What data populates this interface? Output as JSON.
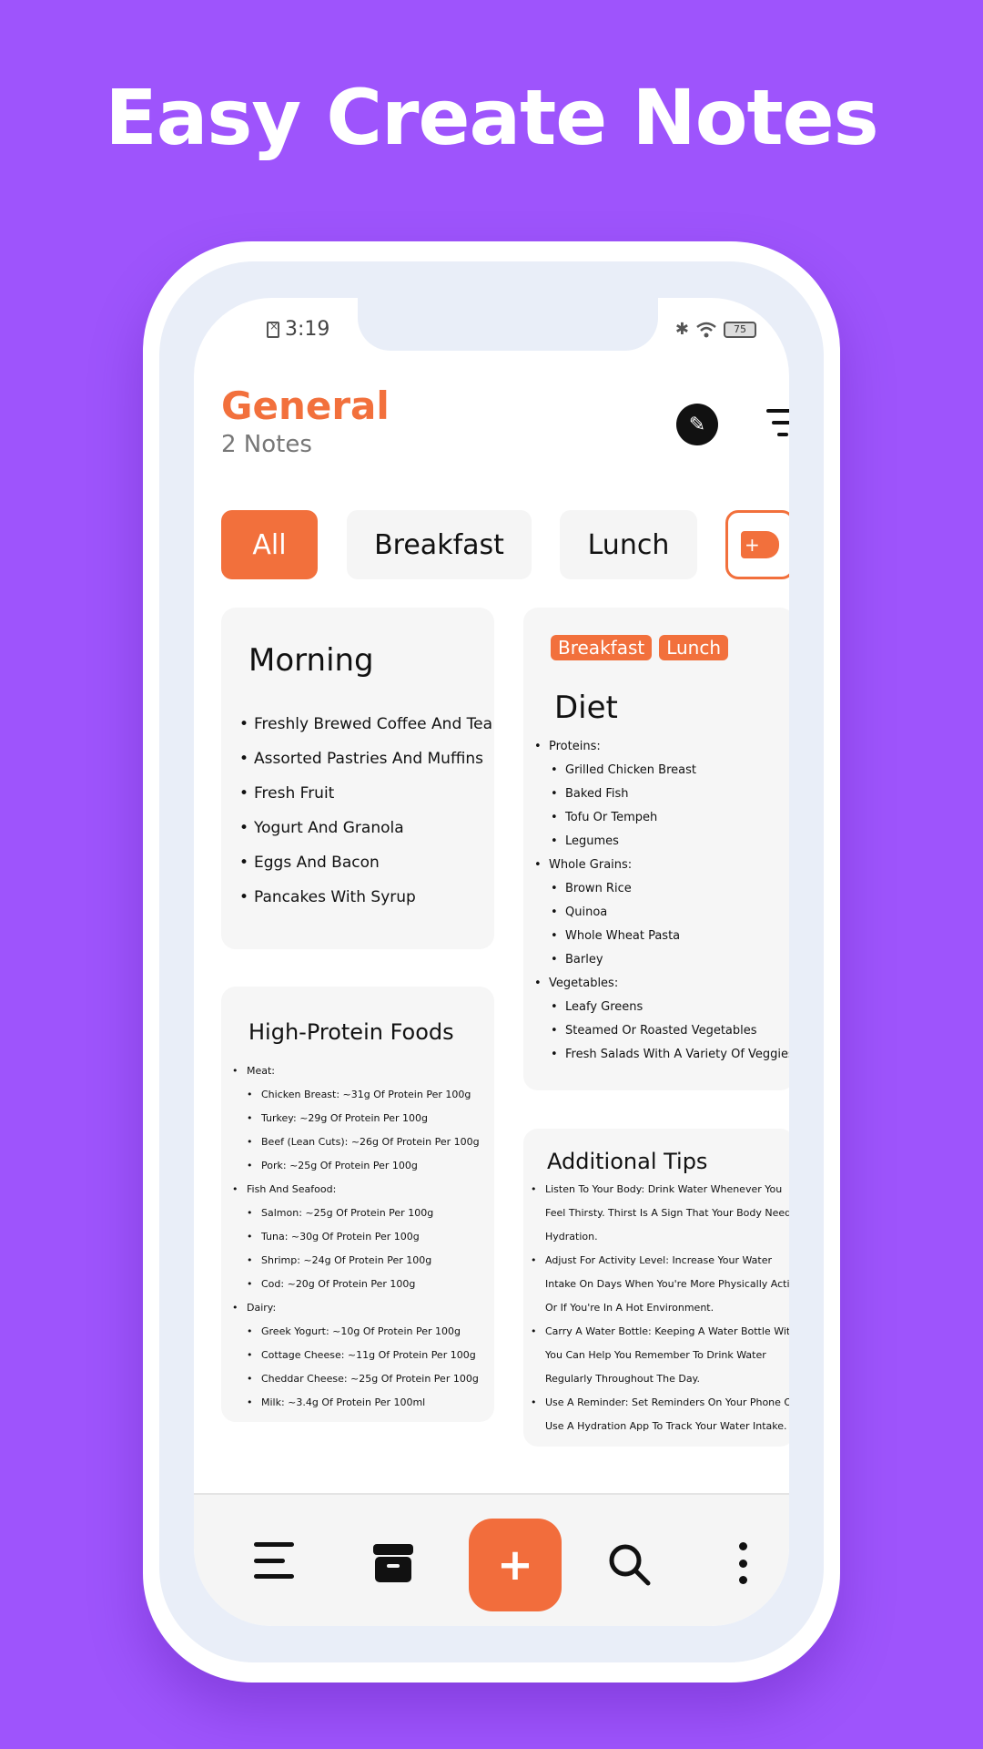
{
  "promo": {
    "headline": "Easy Create Notes"
  },
  "status_bar": {
    "time": "3:19",
    "battery": "75"
  },
  "header": {
    "title": "General",
    "subtitle": "2 Notes"
  },
  "chips": [
    {
      "label": "All"
    },
    {
      "label": "Breakfast"
    },
    {
      "label": "Lunch"
    }
  ],
  "notes": {
    "morning": {
      "title": "Morning",
      "items": [
        "Freshly Brewed Coffee And Tea",
        "Assorted Pastries And Muffins",
        "Fresh Fruit",
        "Yogurt And Granola",
        "Eggs And Bacon",
        "Pancakes With Syrup"
      ]
    },
    "diet": {
      "tags": [
        "Breakfast",
        "Lunch"
      ],
      "title": "Diet",
      "groups": [
        {
          "label": "Proteins:",
          "items": [
            "Grilled Chicken Breast",
            "Baked Fish",
            "Tofu Or Tempeh",
            "Legumes"
          ]
        },
        {
          "label": "Whole Grains:",
          "items": [
            "Brown Rice",
            "Quinoa",
            "Whole Wheat Pasta",
            "Barley"
          ]
        },
        {
          "label": "Vegetables:",
          "items": [
            "Leafy Greens",
            "Steamed Or Roasted Vegetables",
            "Fresh Salads With A Variety Of Veggies"
          ]
        }
      ]
    },
    "protein": {
      "title": "High-Protein Foods",
      "groups": [
        {
          "label": "Meat:",
          "items": [
            "Chicken Breast: ~31g Of Protein Per 100g",
            "Turkey: ~29g Of Protein Per 100g",
            "Beef (Lean Cuts): ~26g Of Protein Per 100g",
            "Pork: ~25g Of Protein Per 100g"
          ]
        },
        {
          "label": "Fish And Seafood:",
          "items": [
            "Salmon: ~25g Of Protein Per 100g",
            "Tuna: ~30g Of Protein Per 100g",
            "Shrimp: ~24g Of Protein Per 100g",
            "Cod: ~20g Of Protein Per 100g"
          ]
        },
        {
          "label": "Dairy:",
          "items": [
            "Greek Yogurt: ~10g Of Protein Per 100g",
            "Cottage Cheese: ~11g Of Protein Per 100g",
            "Cheddar Cheese: ~25g Of Protein Per 100g",
            "Milk: ~3.4g Of Protein Per 100ml"
          ]
        }
      ]
    },
    "tips": {
      "title": "Additional Tips",
      "items": [
        "Listen To Your Body: Drink Water Whenever You Feel Thirsty. Thirst Is A Sign That Your Body Needs Hydration.",
        "Adjust For Activity Level: Increase Your Water Intake On Days When You're More Physically Active Or If You're In A Hot Environment.",
        "Carry A Water Bottle: Keeping A Water Bottle With You Can Help You Remember To Drink Water Regularly Throughout The Day.",
        "Use A Reminder: Set Reminders On Your Phone Or Use A Hydration App To Track Your Water Intake."
      ]
    }
  },
  "colors": {
    "background": "#9e54fc",
    "accent": "#f2703c"
  },
  "bottom_nav": {
    "fab_label": "+",
    "icons": [
      "menu-icon",
      "archive-icon",
      "add-icon",
      "search-icon",
      "more-vertical-icon"
    ]
  }
}
